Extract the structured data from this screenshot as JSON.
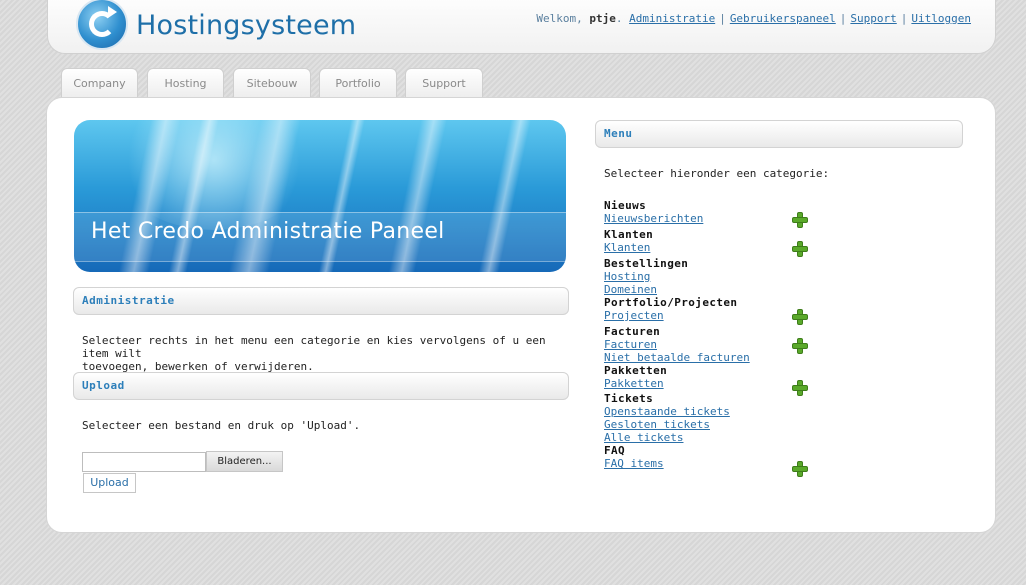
{
  "header": {
    "logo_text": "Hostingsysteem",
    "welcome": "Welkom,",
    "username": "ptje",
    "links": [
      "Administratie",
      "Gebruikerspaneel",
      "Support",
      "Uitloggen"
    ]
  },
  "tabs": [
    "Company",
    "Hosting",
    "Sitebouw",
    "Portfolio",
    "Support"
  ],
  "banner": {
    "title": "Het Credo Administratie Paneel"
  },
  "administratie": {
    "heading": "Administratie",
    "text_line1": "Selecteer rechts in het menu een categorie en kies vervolgens of u een item wilt",
    "text_line2": "toevoegen, bewerken of verwijderen."
  },
  "upload": {
    "heading": "Upload",
    "text": "Selecteer een bestand en druk op 'Upload'.",
    "browse_label": "Bladeren...",
    "button_label": "Upload"
  },
  "menu": {
    "heading": "Menu",
    "intro": "Selecteer hieronder een categorie:",
    "categories": [
      {
        "name": "Nieuws",
        "links": [
          "Nieuwsberichten"
        ]
      },
      {
        "name": "Klanten",
        "links": [
          "Klanten"
        ]
      },
      {
        "name": "Bestellingen",
        "links": [
          "Hosting",
          "Domeinen"
        ]
      },
      {
        "name": "Portfolio/Projecten",
        "links": [
          "Projecten"
        ]
      },
      {
        "name": "Facturen",
        "links": [
          "Facturen",
          "Niet betaalde facturen"
        ]
      },
      {
        "name": "Pakketten",
        "links": [
          "Pakketten"
        ]
      },
      {
        "name": "Tickets",
        "links": [
          "Openstaande tickets",
          "Gesloten tickets",
          "Alle tickets"
        ]
      },
      {
        "name": "FAQ",
        "links": [
          "FAQ items"
        ]
      }
    ]
  },
  "colors": {
    "accent": "#2d7fba",
    "link": "#2a6fa8",
    "add": "#5aa92a"
  }
}
